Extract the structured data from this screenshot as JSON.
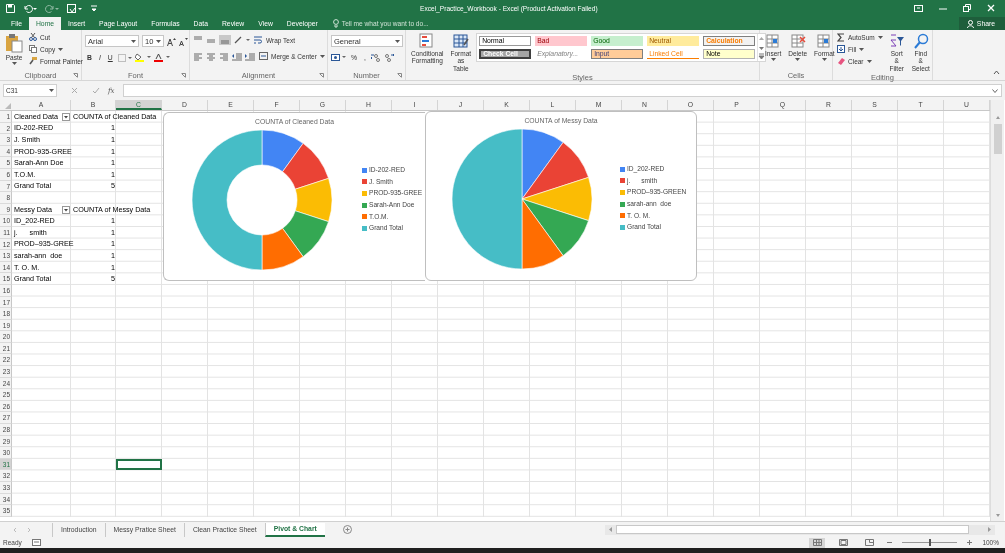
{
  "title_bar": {
    "title": "Excel_Practice_Workbook - Excel (Product Activation Failed)"
  },
  "ribbon_tabs": [
    {
      "label": "File",
      "selected": false
    },
    {
      "label": "Home",
      "selected": true
    },
    {
      "label": "Insert",
      "selected": false
    },
    {
      "label": "Page Layout",
      "selected": false
    },
    {
      "label": "Formulas",
      "selected": false
    },
    {
      "label": "Data",
      "selected": false
    },
    {
      "label": "Review",
      "selected": false
    },
    {
      "label": "View",
      "selected": false
    },
    {
      "label": "Developer",
      "selected": false
    }
  ],
  "tell_me": {
    "placeholder": "Tell me what you want to do..."
  },
  "share": "Share",
  "clipboard": {
    "label": "Clipboard",
    "paste": "Paste",
    "cut": "Cut",
    "copy": "Copy",
    "format_painter": "Format Painter"
  },
  "font": {
    "label": "Font",
    "name": "Arial",
    "size": "10",
    "bold": "B",
    "italic": "I",
    "underline": "U"
  },
  "alignment": {
    "label": "Alignment",
    "wrap_text": "Wrap Text",
    "merge": "Merge & Center"
  },
  "number": {
    "label": "Number",
    "format": "General",
    "percent": "%",
    "comma": ","
  },
  "styles": {
    "label": "Styles",
    "conditional": "Conditional Formatting",
    "format_table": "Format as Table",
    "cells": [
      {
        "label": "Normal",
        "kind": "normal"
      },
      {
        "label": "Bad",
        "kind": "bad"
      },
      {
        "label": "Good",
        "kind": "good"
      },
      {
        "label": "Neutral",
        "kind": "neutral"
      },
      {
        "label": "Calculation",
        "kind": "calculation"
      },
      {
        "label": "Check Cell",
        "kind": "check"
      },
      {
        "label": "Explanatory...",
        "kind": "explanatory"
      },
      {
        "label": "Input",
        "kind": "input"
      },
      {
        "label": "Linked Cell",
        "kind": "linked"
      },
      {
        "label": "Note",
        "kind": "note"
      }
    ]
  },
  "cells_group": {
    "label": "Cells",
    "buttons": [
      "Insert",
      "Delete",
      "Format"
    ]
  },
  "editing": {
    "label": "Editing",
    "autosum": "AutoSum",
    "fill": "Fill",
    "clear": "Clear",
    "sort": "Sort & Filter",
    "find": "Find & Select"
  },
  "formula_bar": {
    "name_box": "C31",
    "fx": "fx"
  },
  "sheet": {
    "columns": [
      {
        "label": "A",
        "selected": false
      },
      {
        "label": "B",
        "selected": false
      },
      {
        "label": "C",
        "selected": true
      },
      {
        "label": "D",
        "selected": false
      },
      {
        "label": "E",
        "selected": false
      },
      {
        "label": "F",
        "selected": false
      },
      {
        "label": "G",
        "selected": false
      },
      {
        "label": "H",
        "selected": false
      },
      {
        "label": "I",
        "selected": false
      },
      {
        "label": "J",
        "selected": false
      },
      {
        "label": "K",
        "selected": false
      },
      {
        "label": "L",
        "selected": false
      },
      {
        "label": "M",
        "selected": false
      },
      {
        "label": "N",
        "selected": false
      },
      {
        "label": "O",
        "selected": false
      },
      {
        "label": "P",
        "selected": false
      },
      {
        "label": "Q",
        "selected": false
      },
      {
        "label": "R",
        "selected": false
      },
      {
        "label": "S",
        "selected": false
      },
      {
        "label": "T",
        "selected": false
      },
      {
        "label": "U",
        "selected": false
      }
    ],
    "rows": [
      {
        "label": "1",
        "selected": false
      },
      {
        "label": "2",
        "selected": false
      },
      {
        "label": "3",
        "selected": false
      },
      {
        "label": "4",
        "selected": false
      },
      {
        "label": "5",
        "selected": false
      },
      {
        "label": "6",
        "selected": false
      },
      {
        "label": "7",
        "selected": false
      },
      {
        "label": "8",
        "selected": false
      },
      {
        "label": "9",
        "selected": false
      },
      {
        "label": "10",
        "selected": false
      },
      {
        "label": "11",
        "selected": false
      },
      {
        "label": "12",
        "selected": false
      },
      {
        "label": "13",
        "selected": false
      },
      {
        "label": "14",
        "selected": false
      },
      {
        "label": "15",
        "selected": false
      },
      {
        "label": "16",
        "selected": false
      },
      {
        "label": "17",
        "selected": false
      },
      {
        "label": "18",
        "selected": false
      },
      {
        "label": "19",
        "selected": false
      },
      {
        "label": "20",
        "selected": false
      },
      {
        "label": "21",
        "selected": false
      },
      {
        "label": "22",
        "selected": false
      },
      {
        "label": "23",
        "selected": false
      },
      {
        "label": "24",
        "selected": false
      },
      {
        "label": "25",
        "selected": false
      },
      {
        "label": "26",
        "selected": false
      },
      {
        "label": "27",
        "selected": false
      },
      {
        "label": "28",
        "selected": false
      },
      {
        "label": "29",
        "selected": false
      },
      {
        "label": "30",
        "selected": false
      },
      {
        "label": "31",
        "selected": true
      },
      {
        "label": "32",
        "selected": false
      },
      {
        "label": "33",
        "selected": false
      },
      {
        "label": "34",
        "selected": false
      },
      {
        "label": "35",
        "selected": false
      }
    ]
  },
  "pivot_tables": [
    {
      "row_label": "Cleaned Data",
      "value_label": "COUNTA of Cleaned Data",
      "rows": [
        {
          "label": "ID-202-RED",
          "count": "1"
        },
        {
          "label": "J. Smith",
          "count": "1"
        },
        {
          "label": "PROD-935-GREE",
          "count": "1"
        },
        {
          "label": "Sarah-Ann Doe",
          "count": "1"
        },
        {
          "label": "T.O.M.",
          "count": "1"
        }
      ],
      "total": {
        "label": "Grand Total",
        "count": "5"
      }
    },
    {
      "row_label": "Messy Data",
      "value_label": "COUNTA of Messy Data",
      "rows": [
        {
          "label": "ID_202-RED",
          "count": "1"
        },
        {
          "label": "j.      smith",
          "count": "1"
        },
        {
          "label": "PROD–935-GREE",
          "count": "1"
        },
        {
          "label": "sarah-ann  doe",
          "count": "1"
        },
        {
          "label": "T. O. M.",
          "count": "1"
        }
      ],
      "total": {
        "label": "Grand Total",
        "count": "5"
      }
    }
  ],
  "charts": [
    {
      "chart_data": {
        "type": "donut",
        "title": "COUNTA of Cleaned Data",
        "categories": [
          "ID-202-RED",
          "J. Smith",
          "PROD-935-GREE",
          "Sarah-Ann Doe",
          "T.O.M.",
          "Grand Total"
        ],
        "values": [
          10,
          10,
          10,
          10,
          10,
          50
        ],
        "legend": "right"
      }
    },
    {
      "chart_data": {
        "type": "pie",
        "title": "COUNTA of Messy Data",
        "categories": [
          "ID_202-RED",
          "j.      smith",
          "PROD–935-GREEN",
          "sarah-ann  doe",
          "T. O. M.",
          "Grand Total"
        ],
        "values": [
          10,
          10,
          10,
          10,
          10,
          50
        ],
        "legend": "right"
      }
    }
  ],
  "sheet_tabs": [
    {
      "label": "Introduction",
      "selected": false
    },
    {
      "label": "Messy Pratice Sheet",
      "selected": false
    },
    {
      "label": "Clean Practice Sheet",
      "selected": false
    },
    {
      "label": "Pivot & Chart",
      "selected": true
    }
  ],
  "status_bar": {
    "status": "Ready",
    "zoom": {
      "level": 0.5,
      "reading": "100%"
    }
  }
}
